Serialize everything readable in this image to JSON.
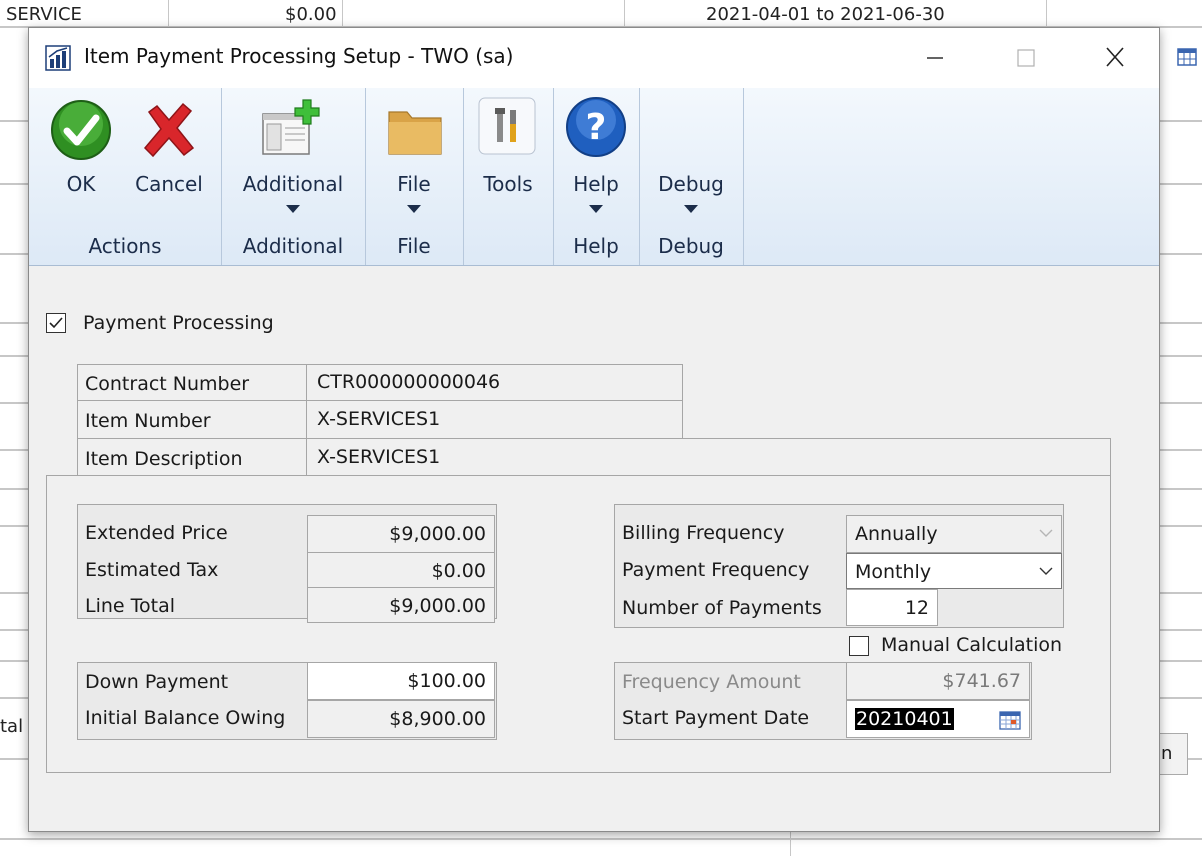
{
  "background": {
    "top_row": {
      "item": "SERVICE",
      "amount": "$0.00",
      "date_range": "2021-04-01 to 2021-06-30"
    },
    "left_fragment": "tal",
    "right_button_fragment": "n"
  },
  "window": {
    "title": "Item Payment Processing Setup  -  TWO (sa)",
    "icons": {
      "app": "chart-icon",
      "minimize": "minimize-icon",
      "maximize": "maximize-icon",
      "close": "close-icon"
    }
  },
  "ribbon": {
    "groups": [
      {
        "name": "Actions",
        "buttons": [
          {
            "label": "OK",
            "icon": "check-icon"
          },
          {
            "label": "Cancel",
            "icon": "x-icon"
          }
        ]
      },
      {
        "name": "Additional",
        "buttons": [
          {
            "label": "Additional",
            "icon": "add-window-icon"
          }
        ]
      },
      {
        "name": "File",
        "buttons": [
          {
            "label": "File",
            "icon": "folder-icon"
          }
        ]
      },
      {
        "name": "",
        "buttons": [
          {
            "label": "Tools",
            "icon": "tools-icon"
          }
        ]
      },
      {
        "name": "Help",
        "buttons": [
          {
            "label": "Help",
            "icon": "help-icon"
          }
        ]
      },
      {
        "name": "Debug",
        "buttons": [
          {
            "label": "Debug",
            "icon": ""
          }
        ]
      }
    ]
  },
  "form": {
    "payment_processing": {
      "label": "Payment Processing",
      "checked": true
    },
    "contract_number": {
      "label": "Contract Number",
      "value": "CTR000000000046"
    },
    "item_number": {
      "label": "Item Number",
      "value": "X-SERVICES1"
    },
    "item_description": {
      "label": "Item Description",
      "value": "X-SERVICES1"
    },
    "extended_price": {
      "label": "Extended Price",
      "value": "$9,000.00"
    },
    "estimated_tax": {
      "label": "Estimated Tax",
      "value": "$0.00"
    },
    "line_total": {
      "label": "Line Total",
      "value": "$9,000.00"
    },
    "down_payment": {
      "label": "Down Payment",
      "value": "$100.00"
    },
    "initial_balance": {
      "label": "Initial Balance Owing",
      "value": "$8,900.00"
    },
    "billing_frequency": {
      "label": "Billing Frequency",
      "value": "Annually"
    },
    "payment_frequency": {
      "label": "Payment Frequency",
      "value": "Monthly"
    },
    "number_of_payments": {
      "label": "Number of Payments",
      "value": "12"
    },
    "manual_calculation": {
      "label": "Manual Calculation",
      "checked": false
    },
    "frequency_amount": {
      "label": "Frequency Amount",
      "value": "$741.67"
    },
    "start_payment_date": {
      "label": "Start Payment Date",
      "value": "20210401",
      "icon": "calendar-icon"
    }
  },
  "colors": {
    "ribbon_top": "#f3f8fd",
    "ribbon_bottom": "#dde9f6",
    "dialog_bg": "#f0f0f0",
    "ok_green": "#3c9a2e",
    "cancel_red": "#d9262b",
    "help_blue": "#1f5fbf",
    "folder": "#e3b35a"
  }
}
